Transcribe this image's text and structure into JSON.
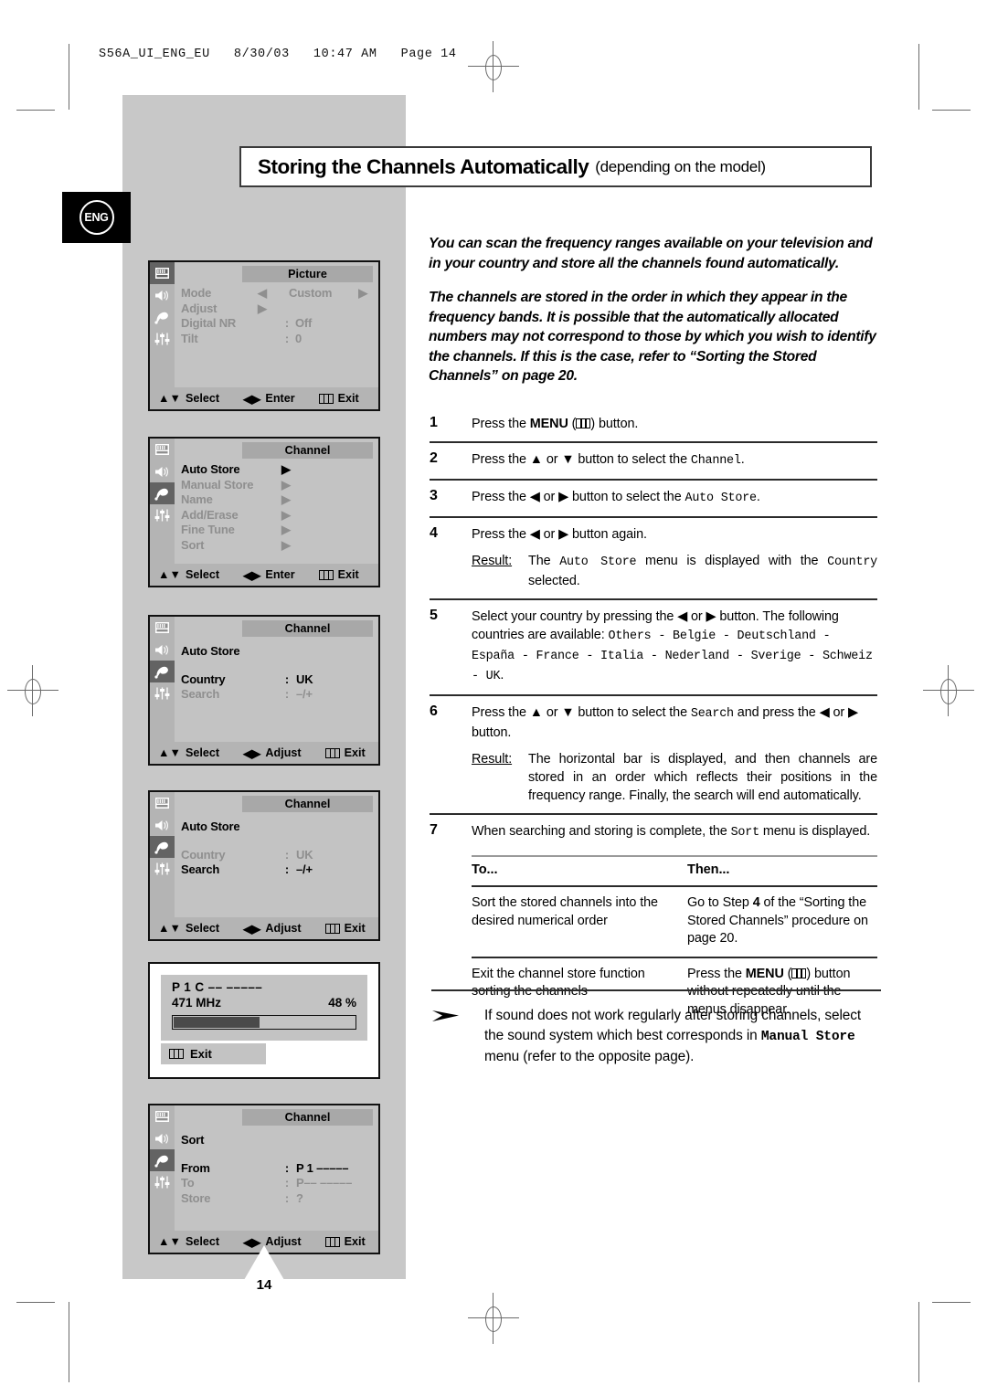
{
  "print_header": "S56A_UI_ENG_EU   8/30/03   10:47 AM   Page 14",
  "language_tab": "ENG",
  "page_number": "14",
  "title": {
    "main": "Storing the Channels Automatically",
    "sub": "(depending on the model)"
  },
  "intro": {
    "p1": "You can scan the frequency ranges available on your television and in your country and store all the channels found automatically.",
    "p2": "The channels are stored in the order in which they appear in the frequency bands. It is possible that the automatically allocated numbers may not correspond to those by which you wish to identify the channels. If this is the case, refer to “Sorting the Stored Channels” on page 20."
  },
  "steps": [
    {
      "num": "1",
      "pre": "Press the ",
      "bold": "MENU",
      "mid": " (",
      "icon": "menu-button-icon",
      "post": ") button."
    },
    {
      "num": "2",
      "text_a": "Press the ▲ or ▼ button to select the ",
      "mono_a": "Channel",
      "text_b": "."
    },
    {
      "num": "3",
      "text_a": "Press the ◀ or ▶ button to select the ",
      "mono_a": "Auto Store",
      "text_b": "."
    },
    {
      "num": "4",
      "text_a": "Press the ◀ or ▶ button again.",
      "result_label": "Result:",
      "result_a": "The ",
      "result_mono_a": "Auto Store",
      "result_b": " menu is displayed with the ",
      "result_mono_b": "Country",
      "result_c": " selected."
    },
    {
      "num": "5",
      "text_a": "Select your country by pressing the ◀ or ▶ button. The following countries are available: ",
      "mono_a": "Others - Belgie - Deutschland - España - France - Italia - Nederland - Sverige - Schweiz - UK",
      "text_b": "."
    },
    {
      "num": "6",
      "text_a": "Press the ▲ or ▼ button to select the ",
      "mono_a": "Search",
      "text_b": " and press the ◀ or ▶ button.",
      "result_label": "Result:",
      "result_a": "The horizontal bar is displayed, and then channels are stored in an order which reflects their positions in the frequency range. Finally, the search will end automatically."
    },
    {
      "num": "7",
      "text_a": "When searching and storing is complete, the ",
      "mono_a": "Sort",
      "text_b": " menu is displayed."
    }
  ],
  "table": {
    "headers": [
      "To...",
      "Then..."
    ],
    "rows": [
      {
        "to": "Sort the stored channels into the desired numerical order",
        "then_a": "Go to Step ",
        "then_bold": "4",
        "then_b": " of the “Sorting the Stored Channels” procedure on page 20."
      },
      {
        "to": "Exit the channel store function sorting the channels",
        "then_a": "Press the ",
        "then_bold": "MENU",
        "then_icon": "menu-button-icon",
        "then_b": " button without repeatedly until the menus disappear."
      }
    ]
  },
  "note": {
    "a": "If sound does not work regularly after storing channels, select the sound system which best corresponds in ",
    "mono": "Manual Store",
    "b": " menu (refer to the opposite page)."
  },
  "osd_footer": {
    "select": "Select",
    "enter": "Enter",
    "adjust": "Adjust",
    "exit": "Exit"
  },
  "osd_menus": [
    {
      "title": "Picture",
      "selected_rail": 0,
      "rows": [
        {
          "label": "Mode",
          "mid": "◀",
          "value": "Custom",
          "right": "▶",
          "state": "dim"
        },
        {
          "label": "Adjust",
          "mid": "▶",
          "value": "",
          "state": "dim"
        },
        {
          "label": "Digital NR",
          "mid": ":",
          "value": "Off",
          "state": "dim"
        },
        {
          "label": "Tilt",
          "mid": ":",
          "value": "0",
          "state": "dim"
        }
      ],
      "footer": [
        "Select",
        "Enter",
        "Exit"
      ]
    },
    {
      "title": "Channel",
      "selected_rail": 2,
      "rows": [
        {
          "label": "Auto Store",
          "mid": "",
          "value": "▶",
          "state": "on"
        },
        {
          "label": "Manual Store",
          "mid": "",
          "value": "▶",
          "state": "dim"
        },
        {
          "label": "Name",
          "mid": "",
          "value": "▶",
          "state": "dim"
        },
        {
          "label": "Add/Erase",
          "mid": "",
          "value": "▶",
          "state": "dim"
        },
        {
          "label": "Fine Tune",
          "mid": "",
          "value": "▶",
          "state": "dim"
        },
        {
          "label": "Sort",
          "mid": "",
          "value": "▶",
          "state": "dim"
        }
      ],
      "footer": [
        "Select",
        "Enter",
        "Exit"
      ]
    },
    {
      "title": "Channel",
      "selected_rail": 2,
      "rows": [
        {
          "label": "Auto Store",
          "mid": "",
          "value": "",
          "state": "on"
        },
        {
          "label": "",
          "mid": "",
          "value": "",
          "state": "on"
        },
        {
          "label": "Country",
          "mid": ":",
          "value": "UK",
          "state": "on"
        },
        {
          "label": "Search",
          "mid": ":",
          "value": "–/+",
          "state": "dim"
        }
      ],
      "footer": [
        "Select",
        "Adjust",
        "Exit"
      ]
    },
    {
      "title": "Channel",
      "selected_rail": 2,
      "rows": [
        {
          "label": "Auto Store",
          "mid": "",
          "value": "",
          "state": "on"
        },
        {
          "label": "",
          "mid": "",
          "value": "",
          "state": "on"
        },
        {
          "label": "Country",
          "mid": ":",
          "value": "UK",
          "state": "dim"
        },
        {
          "label": "Search",
          "mid": ":",
          "value": "–/+",
          "state": "on"
        }
      ],
      "footer": [
        "Select",
        "Adjust",
        "Exit"
      ]
    }
  ],
  "progress_osd": {
    "line1": "P 1 C ––  –––––",
    "frequency": "471 MHz",
    "percent": "48 %",
    "progress_value": 48,
    "exit": "Exit"
  },
  "sort_osd": {
    "title": "Channel",
    "selected_rail": 2,
    "heading": "Sort",
    "rows": [
      {
        "label": "From",
        "mid": ":",
        "value": "P 1  –––––",
        "state": "on"
      },
      {
        "label": "To",
        "mid": ":",
        "value": "P––  –––––",
        "state": "dim"
      },
      {
        "label": "Store",
        "mid": ":",
        "value": " ?",
        "state": "dim"
      }
    ],
    "footer": [
      "Select",
      "Adjust",
      "Exit"
    ]
  },
  "colors": {
    "panel_grey": "#c8c8c8",
    "osd_bg": "#c3c3c3",
    "osd_rail": "#b4b4b4",
    "osd_title": "#a8a8a8",
    "osd_dim_text": "#8f8f8f",
    "progress_fill": "#4a4a4a"
  }
}
